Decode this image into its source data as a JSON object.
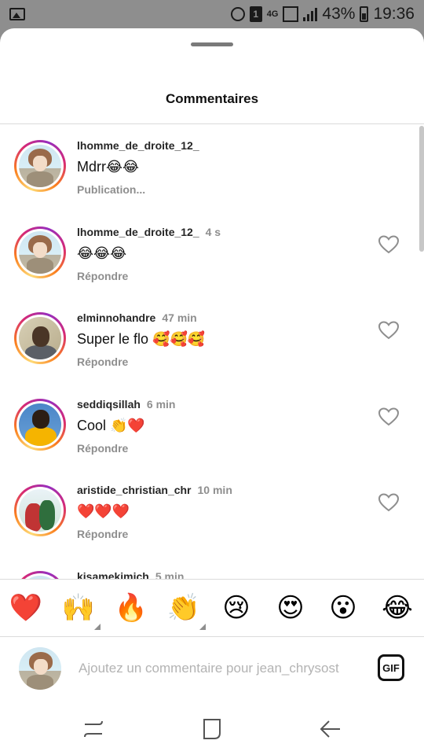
{
  "status_bar": {
    "network": "4G",
    "sim": "1",
    "battery": "43%",
    "time": "19:36"
  },
  "sheet": {
    "title": "Commentaires"
  },
  "comments": [
    {
      "username": "lhomme_de_droite_12_",
      "time": "",
      "text": "Mdrr😂😂",
      "action": "Publication...",
      "avatar": "anime"
    },
    {
      "username": "lhomme_de_droite_12_",
      "time": "4 s",
      "text": "😂😂😂",
      "action": "Répondre",
      "avatar": "anime"
    },
    {
      "username": "elminnohandre",
      "time": "47 min",
      "text": "Super le flo 🥰🥰🥰",
      "action": "Répondre",
      "avatar": "photo1"
    },
    {
      "username": "seddiqsillah",
      "time": "6 min",
      "text": "Cool 👏❤️",
      "action": "Répondre",
      "avatar": "photo2"
    },
    {
      "username": "aristide_christian_chr",
      "time": "10 min",
      "text": "❤️❤️❤️",
      "action": "Répondre",
      "avatar": "photo3"
    },
    {
      "username": "kisamekimich",
      "time": "5 min",
      "text": "",
      "action": "",
      "avatar": "anime"
    }
  ],
  "emoji_bar": [
    "❤️",
    "🙌",
    "🔥",
    "👏",
    "😢",
    "😍",
    "😮",
    "😂"
  ],
  "composer": {
    "placeholder": "Ajoutez un commentaire pour jean_chrysost",
    "gif_label": "GIF"
  },
  "colors": {
    "story_ring_start": "#feda75",
    "story_ring_end": "#d62976",
    "secondary_text": "#8e8e8e"
  }
}
